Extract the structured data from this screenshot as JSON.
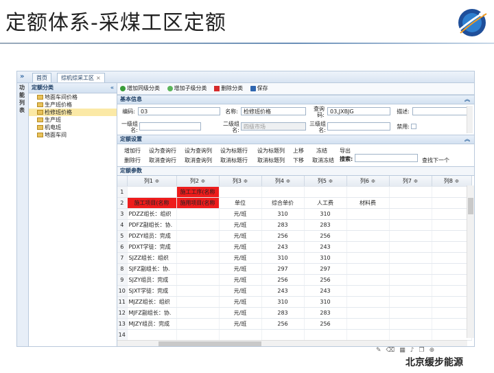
{
  "slide": {
    "title": "定额体系-采煤工区定额",
    "brand": "北京缓步能源"
  },
  "topbar": {
    "toggle": "»",
    "tabs": [
      {
        "label": "首页"
      },
      {
        "label": "综机综采工区",
        "close": "×"
      }
    ]
  },
  "sidebar_label": [
    "功",
    "能",
    "列",
    "表"
  ],
  "tree": {
    "title": "定额分类",
    "collapse": "«",
    "items": [
      "地面车间价格",
      "生产班价格",
      "检修班价格",
      "生产班",
      "机电班",
      "地面车间"
    ],
    "selected_index": 2
  },
  "toolbar": {
    "buttons": [
      "增加同级分类",
      "增加子级分类",
      "删除分类",
      "保存"
    ]
  },
  "basic": {
    "title": "基本信息",
    "code_label": "编码:",
    "code_value": "03",
    "name_label": "名称:",
    "name_value": "检修班价格",
    "query_label": "查询码:",
    "query_value": "03,JXBJG",
    "desc_label": "描述:",
    "desc_value": "",
    "l1_label": "一级组名:",
    "l1_value": "",
    "l2_label": "二级组名:",
    "l2_value": "四级市场",
    "l3_label": "三级组名:",
    "l3_value": "",
    "disable_label": "禁用:"
  },
  "settings": {
    "title": "定额设置",
    "row1": [
      "增加行",
      "设为查询行",
      "设为查询列",
      "设为标题行",
      "设为标题列",
      "上移",
      "冻结",
      "导出"
    ],
    "row2": [
      "删除行",
      "取消查询行",
      "取消查询列",
      "取消标题行",
      "取消标题列",
      "下移",
      "取消冻结"
    ],
    "search_label": "搜索:",
    "find_next": "查找下一个"
  },
  "params": {
    "title": "定额参数",
    "columns": [
      "列1 ≑",
      "列2 ≑",
      "列3 ≑",
      "列4 ≑",
      "列5 ≑",
      "列6 ≑",
      "列7 ≑",
      "列8 ≑"
    ],
    "rows": [
      [
        "1",
        "",
        "施工工序(名称",
        "",
        "",
        "",
        "",
        "",
        ""
      ],
      [
        "2",
        "施工项目(名称",
        "施用项目(名称",
        "单位",
        "综合单价",
        "人工费",
        "材料费",
        "",
        ""
      ],
      [
        "3",
        "PDZZ组长：组织",
        "",
        "元/班",
        "310",
        "310",
        "",
        "",
        ""
      ],
      [
        "4",
        "PDFZ副组长：协.",
        "",
        "元/班",
        "283",
        "283",
        "",
        "",
        ""
      ],
      [
        "5",
        "PDZY组员：完成",
        "",
        "元/班",
        "256",
        "256",
        "",
        "",
        ""
      ],
      [
        "6",
        "PDXT学徒：完成",
        "",
        "元/班",
        "243",
        "243",
        "",
        "",
        ""
      ],
      [
        "7",
        "SJZZ组长：组织",
        "",
        "元/班",
        "310",
        "310",
        "",
        "",
        ""
      ],
      [
        "8",
        "SJFZ副组长：协.",
        "",
        "元/班",
        "297",
        "297",
        "",
        "",
        ""
      ],
      [
        "9",
        "SJZY组员：完成",
        "",
        "元/班",
        "256",
        "256",
        "",
        "",
        ""
      ],
      [
        "10",
        "SJXT学徒：完成",
        "",
        "元/班",
        "243",
        "243",
        "",
        "",
        ""
      ],
      [
        "11",
        "MJZZ组长：组织",
        "",
        "元/班",
        "310",
        "310",
        "",
        "",
        ""
      ],
      [
        "12",
        "MJFZ副组长：协.",
        "",
        "元/班",
        "283",
        "283",
        "",
        "",
        ""
      ],
      [
        "13",
        "MJZY组员：完成",
        "",
        "元/班",
        "256",
        "256",
        "",
        "",
        ""
      ],
      [
        "14",
        "",
        "",
        "",
        "",
        "",
        "",
        "",
        ""
      ]
    ]
  },
  "footer_icons": [
    "pen-icon",
    "eraser-icon",
    "grid-icon",
    "speaker-icon",
    "window-icon",
    "zoom-icon"
  ]
}
